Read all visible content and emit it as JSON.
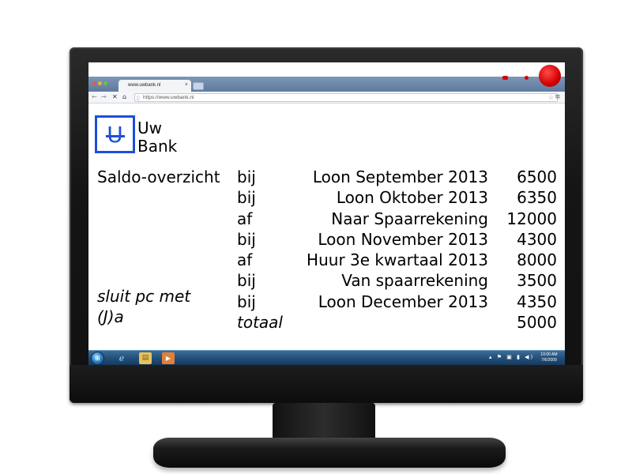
{
  "browser": {
    "tab_title": "www.uwbank.nl",
    "tab_close": "×",
    "url": "https://www.uwbank.nl"
  },
  "icons": {
    "back": "arrow-left-icon",
    "forward": "arrow-right-icon",
    "stop": "close-icon",
    "home": "home-icon",
    "star": "star-icon",
    "menu": "menu-icon",
    "start": "windows-start-icon",
    "ie": "internet-explorer-icon",
    "folder": "folder-icon",
    "media": "media-player-icon"
  },
  "logo": {
    "letter": "U",
    "line1": "Uw",
    "line2": "Bank"
  },
  "page": {
    "label": "Saldo-overzicht",
    "prompt_line1": "sluit pc met",
    "prompt_line2": "(J)a"
  },
  "transactions": [
    {
      "type": "bij",
      "description": "Loon September 2013",
      "amount": "6500"
    },
    {
      "type": "bij",
      "description": "Loon Oktober 2013",
      "amount": "6350"
    },
    {
      "type": "af",
      "description": "Naar Spaarrekening",
      "amount": "12000"
    },
    {
      "type": "bij",
      "description": "Loon November 2013",
      "amount": "4300"
    },
    {
      "type": "af",
      "description": "Huur 3e kwartaal 2013",
      "amount": "8000"
    },
    {
      "type": "bij",
      "description": "Van spaarrekening",
      "amount": "3500"
    },
    {
      "type": "bij",
      "description": "Loon December 2013",
      "amount": "4350"
    }
  ],
  "total": {
    "label": "totaal",
    "amount": "5000"
  },
  "taskbar": {
    "time": "10:00 AM",
    "date": "7/6/2009"
  },
  "colors": {
    "logo_blue": "#1d4fd8",
    "taskbar": "#23507a",
    "monitor": "#151515"
  }
}
